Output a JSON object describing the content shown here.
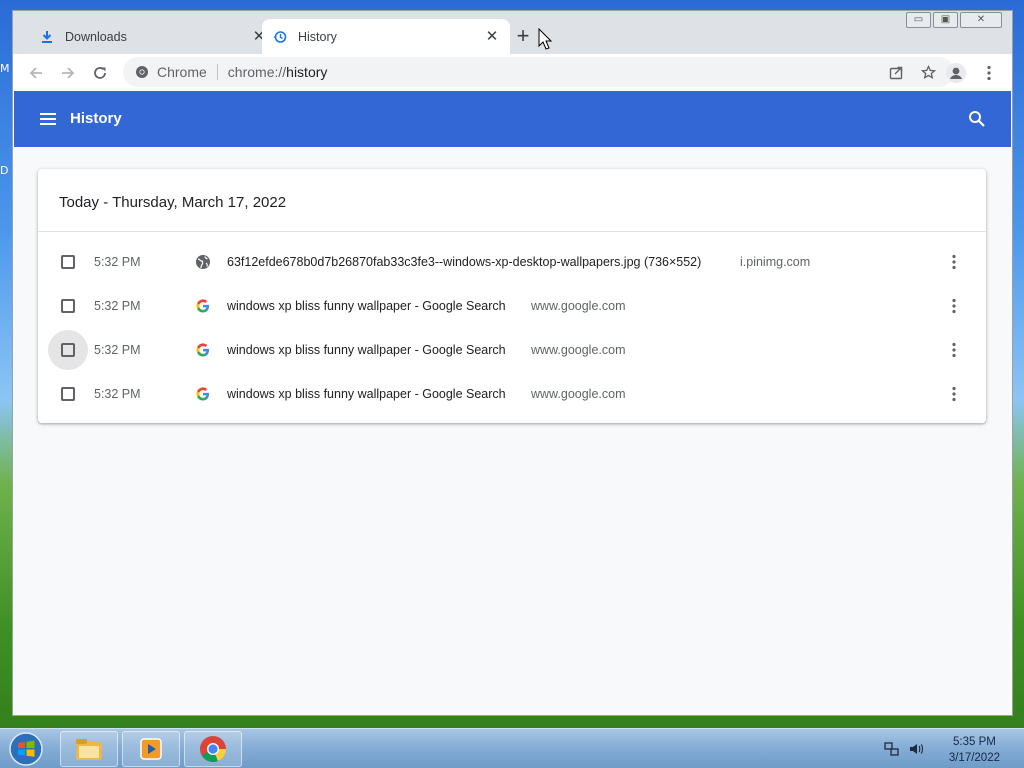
{
  "desktop": {
    "edge_letters": [
      "M",
      "D"
    ]
  },
  "window_controls": {
    "minimize": "▭",
    "maximize": "▣",
    "close": "✕"
  },
  "tabs": [
    {
      "label": "Downloads",
      "icon": "download-icon",
      "close": "✕",
      "active": false
    },
    {
      "label": "History",
      "icon": "history-icon",
      "close": "✕",
      "active": true
    }
  ],
  "new_tab": "+",
  "omnibox": {
    "site": "Chrome",
    "scheme": "chrome://",
    "path": "history"
  },
  "header": {
    "title": "History"
  },
  "day_heading": "Today - Thursday, March 17, 2022",
  "entries": [
    {
      "time": "5:32 PM",
      "favicon": "globe-icon",
      "title": "63f12efde678b0d7b26870fab33c3fe3--windows-xp-desktop-wallpapers.jpg (736×552)",
      "domain": "i.pinimg.com",
      "hovered": false
    },
    {
      "time": "5:32 PM",
      "favicon": "google-icon",
      "title": "windows xp bliss funny wallpaper - Google Search",
      "domain": "www.google.com",
      "hovered": false
    },
    {
      "time": "5:32 PM",
      "favicon": "google-icon",
      "title": "windows xp bliss funny wallpaper - Google Search",
      "domain": "www.google.com",
      "hovered": true
    },
    {
      "time": "5:32 PM",
      "favicon": "google-icon",
      "title": "windows xp bliss funny wallpaper - Google Search",
      "domain": "www.google.com",
      "hovered": false
    }
  ],
  "taskbar": {
    "items": [
      "file-explorer-icon",
      "media-player-icon",
      "chrome-icon"
    ],
    "clock_time": "5:35 PM",
    "clock_date": "3/17/2022"
  },
  "colors": {
    "header": "#3367d6",
    "page": "#f8f9fa",
    "tabstrip": "#dee1e6"
  }
}
